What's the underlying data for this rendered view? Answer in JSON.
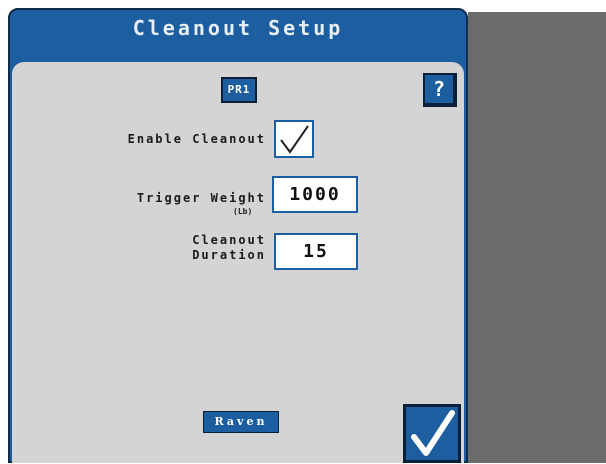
{
  "window": {
    "title": "Cleanout Setup"
  },
  "toolbar": {
    "product_label": "PR1",
    "help_label": "?"
  },
  "form": {
    "enable_cleanout": {
      "label": "Enable Cleanout",
      "checked": true
    },
    "trigger_weight": {
      "label": "Trigger Weight",
      "unit": "(Lb)",
      "value": "1000"
    },
    "cleanout_duration": {
      "label_line1": "Cleanout",
      "label_line2": "Duration",
      "value": "15"
    }
  },
  "footer": {
    "brand": "Raven",
    "accept_icon": "checkmark-icon"
  },
  "colors": {
    "accent": "#1c5ea0",
    "panel": "#d4d4d4",
    "side": "#6b6b6b"
  }
}
